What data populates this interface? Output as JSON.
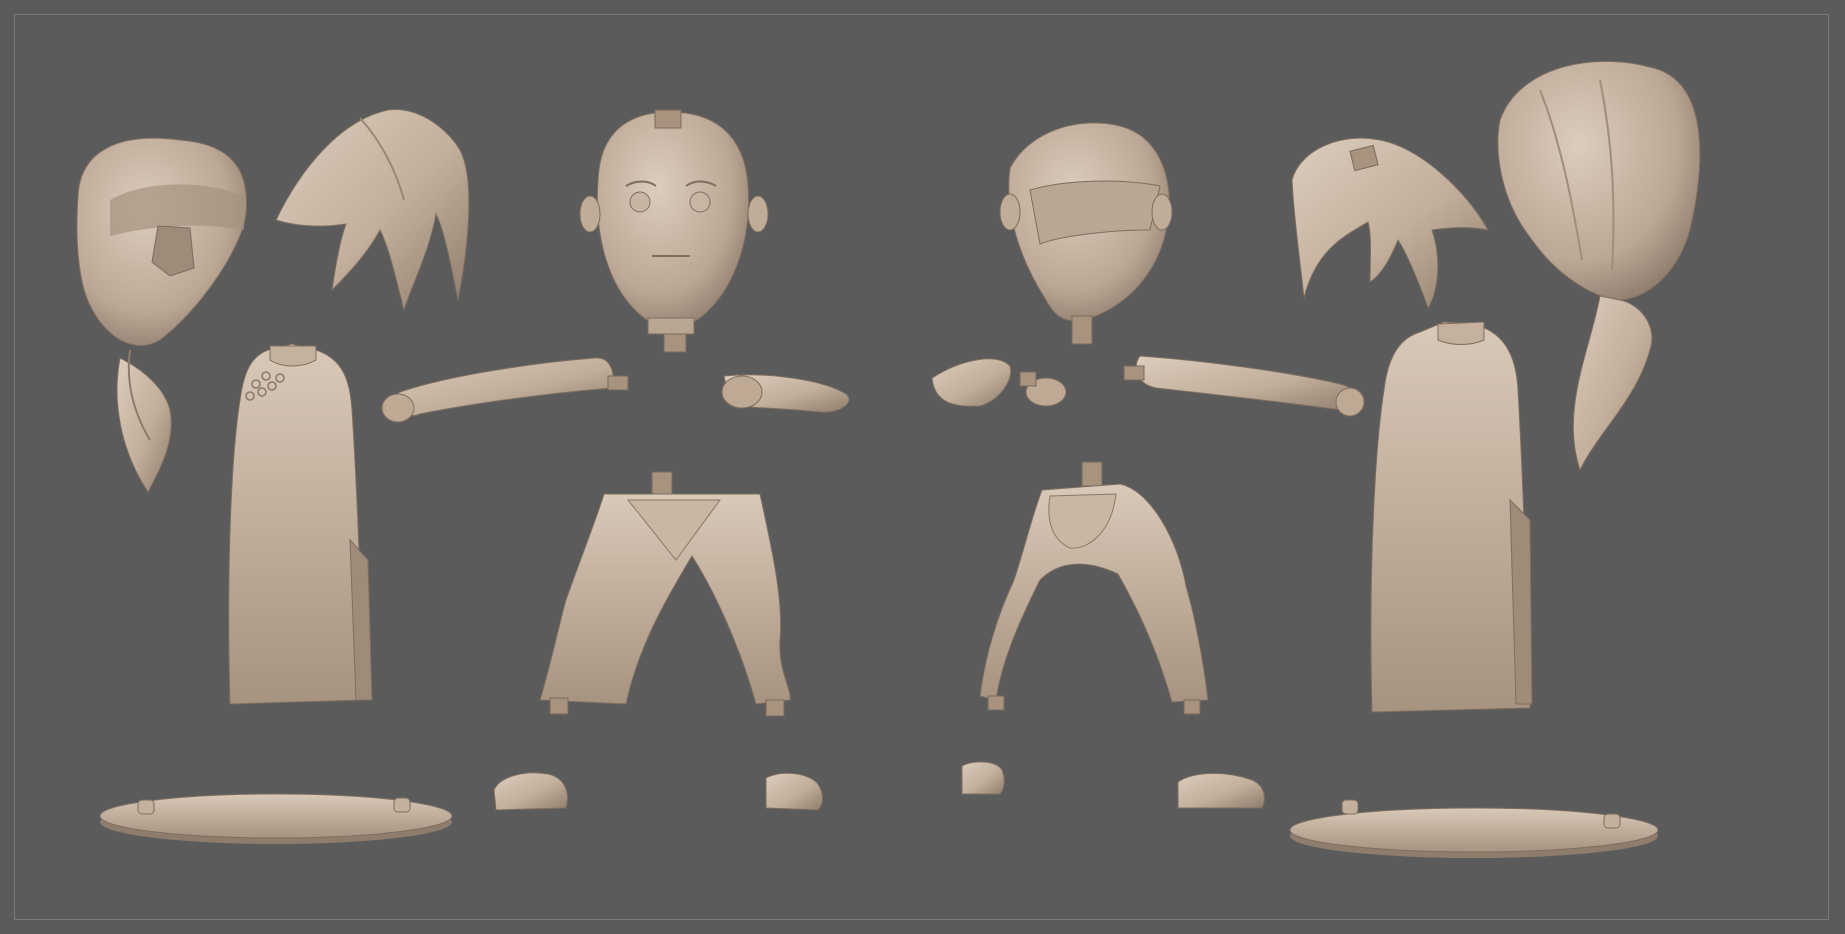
{
  "viewport": {
    "background_color": "#5b5b5c",
    "frame_color": "#7a7a7b",
    "material_color": "#c7b5a3",
    "material_shadow_color": "#8f7f70",
    "material_highlight_color": "#ddd0c2"
  },
  "parts": [
    {
      "name": "hair-back-bun-left",
      "description_icon": "hair-icon"
    },
    {
      "name": "hair-ponytail-left",
      "description_icon": "hair-icon"
    },
    {
      "name": "head-front",
      "description_icon": "head-icon"
    },
    {
      "name": "head-back",
      "description_icon": "head-icon"
    },
    {
      "name": "hair-ponytail-right",
      "description_icon": "hair-icon"
    },
    {
      "name": "hair-long-right",
      "description_icon": "hair-icon"
    },
    {
      "name": "dress-front",
      "description_icon": "dress-icon"
    },
    {
      "name": "dress-back",
      "description_icon": "dress-icon"
    },
    {
      "name": "arms",
      "description_icon": "arm-icon"
    },
    {
      "name": "legs-front",
      "description_icon": "legs-icon"
    },
    {
      "name": "legs-back",
      "description_icon": "legs-icon"
    },
    {
      "name": "shoes",
      "description_icon": "shoe-icon"
    },
    {
      "name": "bases",
      "description_icon": "base-icon"
    }
  ]
}
